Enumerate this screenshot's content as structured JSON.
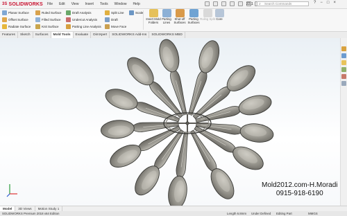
{
  "app": {
    "brand": "SOLIDWORKS",
    "brand_prefix": "3S"
  },
  "menus": [
    "File",
    "Edit",
    "View",
    "Insert",
    "Tools",
    "Window",
    "Help"
  ],
  "quick_access": {
    "zoom": "22.1"
  },
  "search": {
    "placeholder": "Search Commands"
  },
  "window_buttons": {
    "minimize": "−",
    "restore": "□",
    "close": "×"
  },
  "ribbon": {
    "col1": [
      "Planar Surface",
      "Offset Surface",
      "Radiate Surface"
    ],
    "col2": [
      "Ruled Surface",
      "Filled Surface",
      "Knit Surface"
    ],
    "col3": [
      "Draft Analysis",
      "Undercut Analysis",
      "Parting Line Analysis"
    ],
    "col4": [
      "Split Line",
      "Draft",
      "Move Face"
    ],
    "scale": "Scale",
    "big": [
      {
        "label": "Insert Mold Folders",
        "disabled": false
      },
      {
        "label": "Parting Lines",
        "disabled": false
      },
      {
        "label": "Shut-off Surfaces",
        "disabled": false
      },
      {
        "label": "Parting Surfaces",
        "disabled": false
      },
      {
        "label": "Ruling Split",
        "disabled": true
      },
      {
        "label": "Core",
        "disabled": false
      }
    ]
  },
  "tabs": [
    "Features",
    "Sketch",
    "Surfaces",
    "Mold Tools",
    "Evaluate",
    "DimXpert",
    "SOLIDWORKS Add-Ins",
    "SOLIDWORKS MBD"
  ],
  "active_tab": "Mold Tools",
  "watermark": {
    "line1": "Mold2012.com-H.Moradi",
    "line2": "0915-918-6190"
  },
  "bottom_tabs": [
    "Model",
    "3D Views",
    "Motion Study 1"
  ],
  "active_bottom_tab": "Model",
  "status": {
    "edition": "SOLIDWORKS Premium 2018 x64 Edition",
    "length": "Length 6.8mm",
    "state": "Under Defined",
    "mode": "Editing Part",
    "units": "MMGS"
  },
  "colors": {
    "brand_red": "#c8102e",
    "spoon": "#9a9890",
    "viewport_top": "#eaf0f5"
  }
}
